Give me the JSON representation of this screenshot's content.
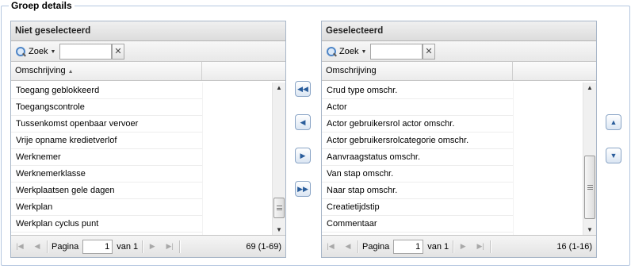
{
  "legend": "Groep details",
  "left": {
    "title": "Niet geselecteerd",
    "search_label": "Zoek",
    "search_value": "",
    "column": "Omschrijving",
    "rows": [
      "Toegang geblokkeerd",
      "Toegangscontrole",
      "Tussenkomst openbaar vervoer",
      "Vrije opname kredietverlof",
      "Werknemer",
      "Werknemerklasse",
      "Werkplaatsen gele dagen",
      "Werkplan",
      "Werkplan cyclus punt"
    ],
    "pager": {
      "page_label": "Pagina",
      "page": "1",
      "of_label": "van 1",
      "info": "69 (1-69)"
    }
  },
  "right": {
    "title": "Geselecteerd",
    "search_label": "Zoek",
    "search_value": "",
    "column": "Omschrijving",
    "rows": [
      "Crud type omschr.",
      "Actor",
      "Actor gebruikersrol actor omschr.",
      "Actor gebruikersrolcategorie omschr.",
      "Aanvraagstatus omschr.",
      "Van stap omschr.",
      "Naar stap omschr.",
      "Creatietijdstip",
      "Commentaar"
    ],
    "pager": {
      "page_label": "Pagina",
      "page": "1",
      "of_label": "van 1",
      "info": "16 (1-16)"
    }
  },
  "icons": {
    "move_all_left": "double-left-arrow-icon",
    "move_left": "left-arrow-icon",
    "move_right": "right-arrow-icon",
    "move_all_right": "double-right-arrow-icon",
    "move_up": "up-arrow-icon",
    "move_down": "down-arrow-icon"
  },
  "colors": {
    "frame": "#b5c7e0",
    "button_border": "#8aa5c6",
    "button_glyph": "#2a5d9b"
  }
}
